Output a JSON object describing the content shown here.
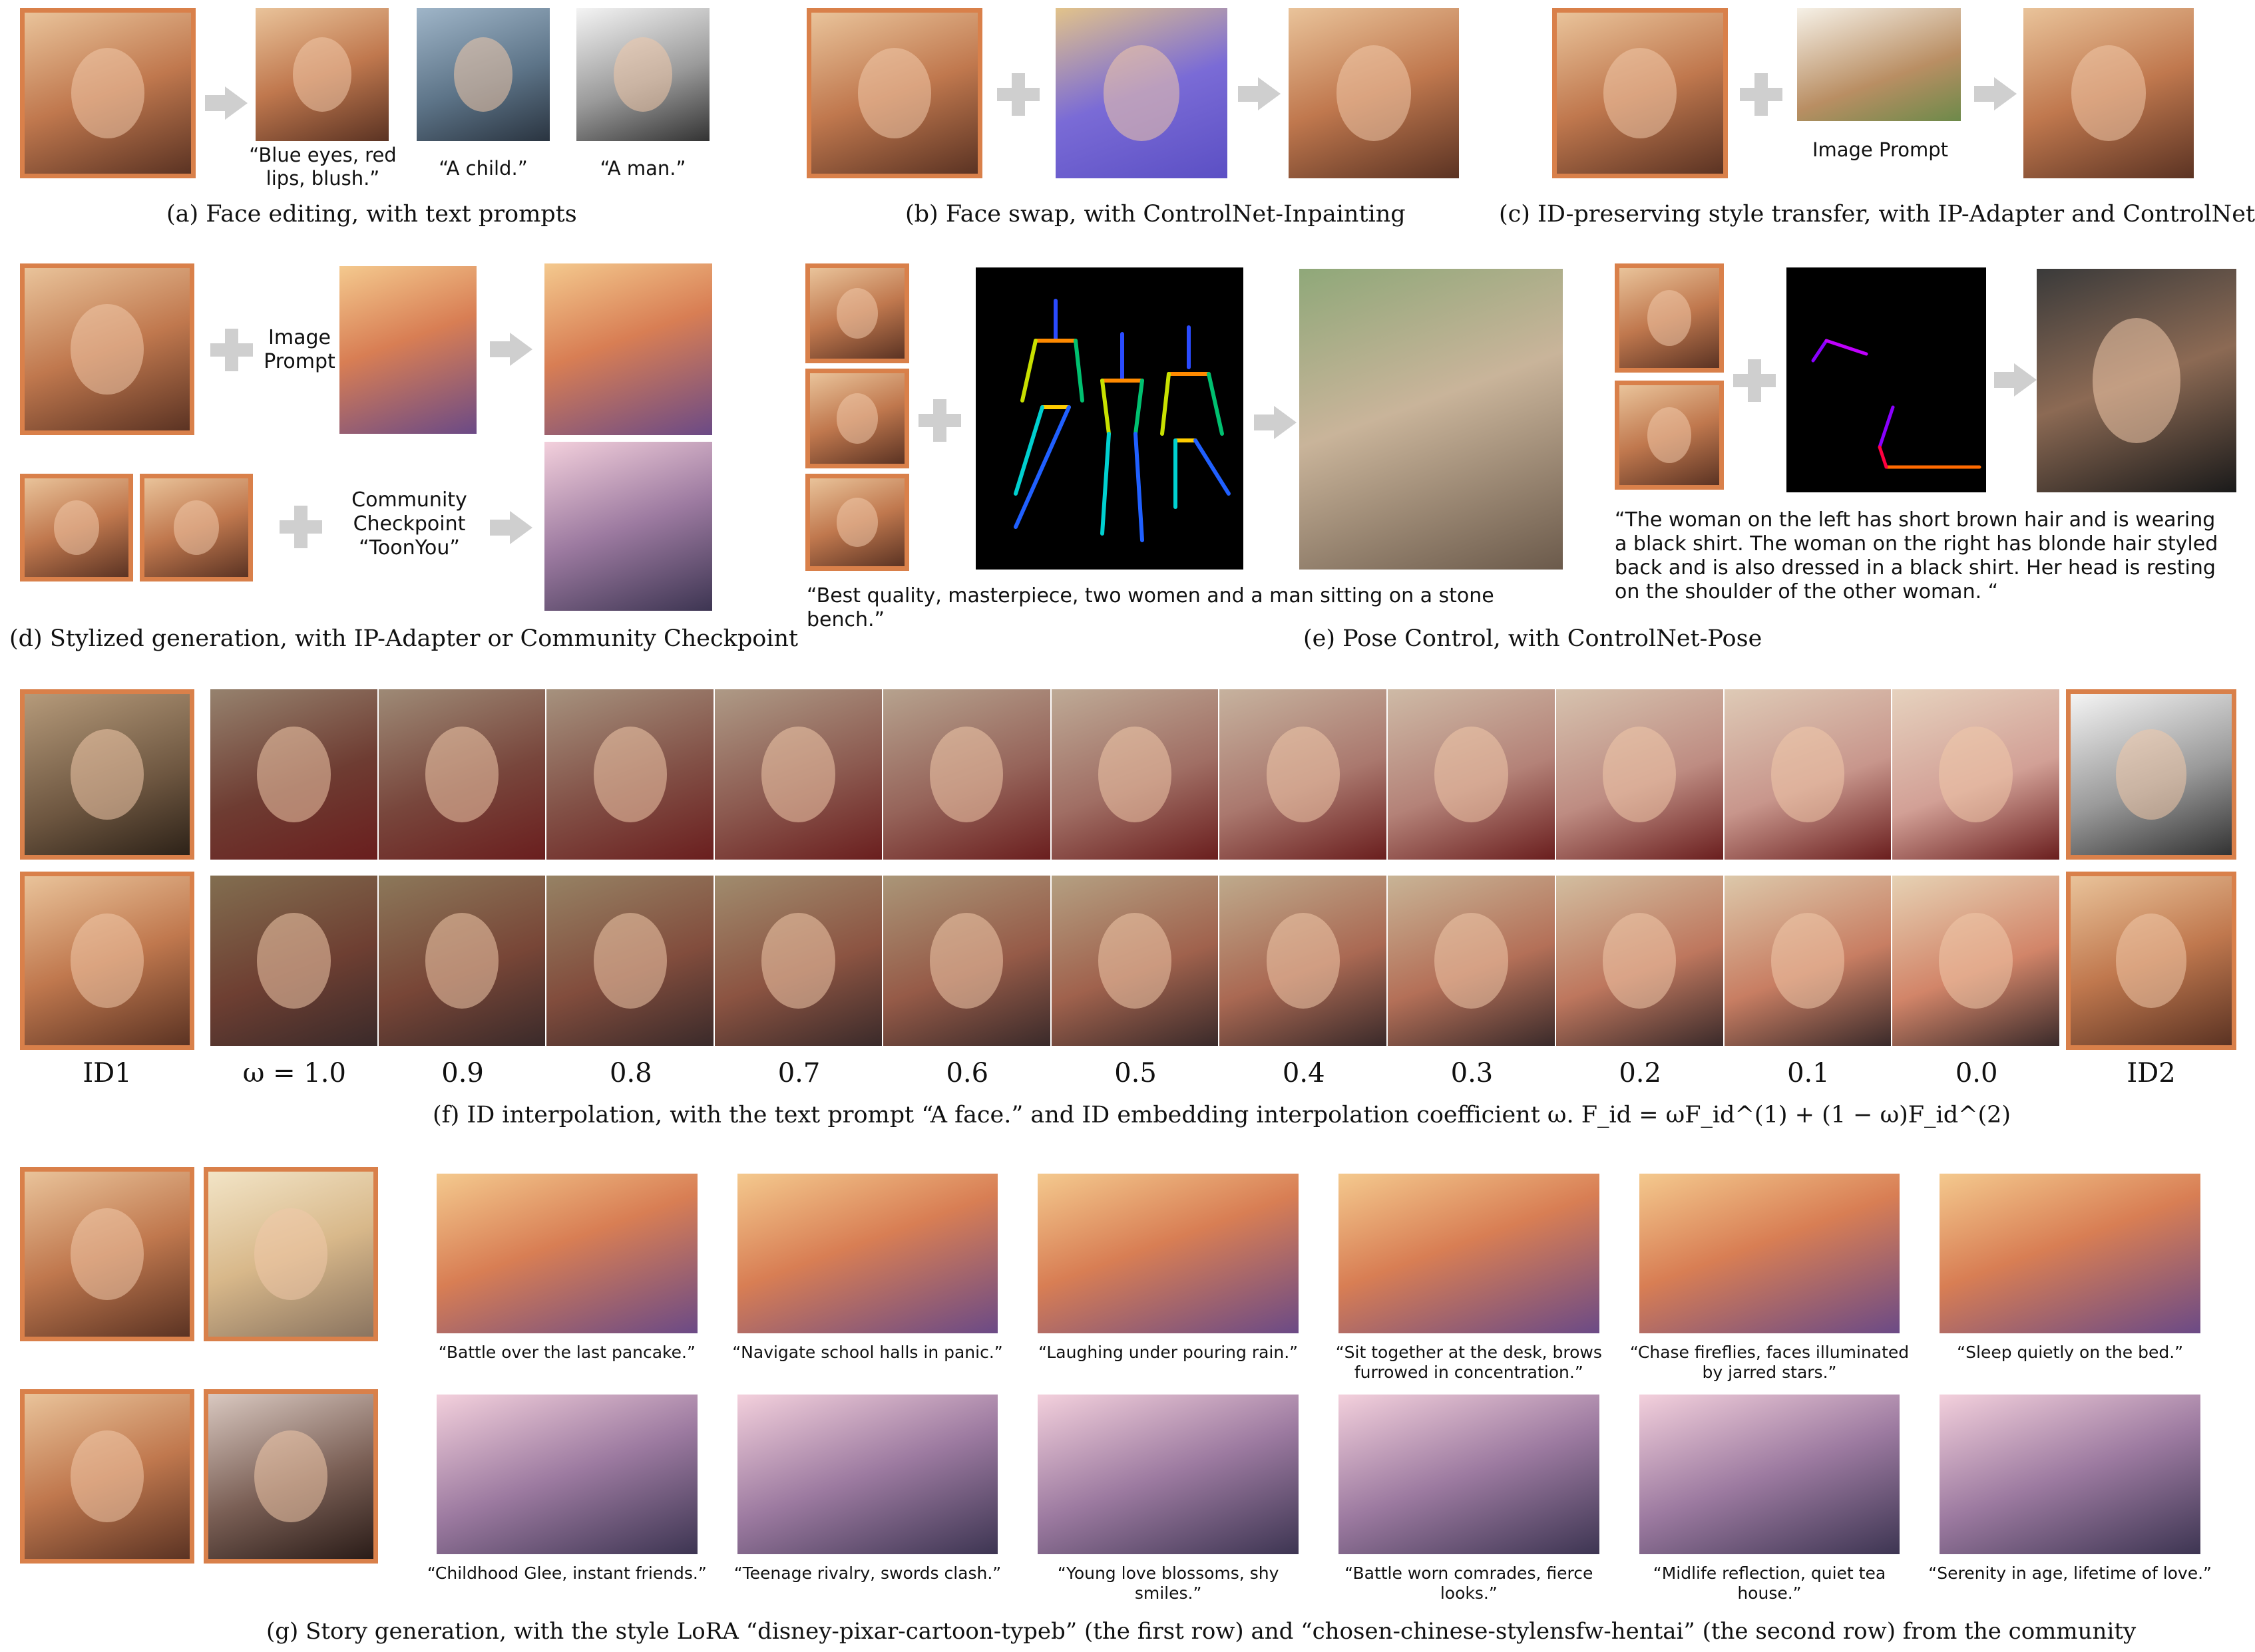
{
  "panels": {
    "a": {
      "caption": "(a) Face editing, with text prompts",
      "prompts": [
        "“Blue eyes, red lips, blush.”",
        "“A child.”",
        "“A man.”"
      ]
    },
    "b": {
      "caption": "(b) Face swap, with ControlNet-Inpainting"
    },
    "c": {
      "caption": "(c) ID-preserving style transfer, with IP-Adapter and ControlNet-Edge",
      "image_prompt_label": "Image Prompt"
    },
    "d": {
      "caption": "(d) Stylized generation, with IP-Adapter or Community Checkpoint",
      "image_prompt_label": "Image Prompt",
      "checkpoint_label": "Community Checkpoint “ToonYou”"
    },
    "e": {
      "caption": "(e) Pose Control, with ControlNet-Pose",
      "prompt_left": "“Best quality, masterpiece, two women and a man sitting on a stone bench.”",
      "prompt_right": "“The woman on the left has short brown hair and is wearing a black shirt. The woman on the right has blonde hair styled back and is also dressed in a black shirt. Her head is resting on the shoulder of the other woman. “"
    },
    "f": {
      "caption": "(f) ID interpolation, with the text prompt “A face.” and ID embedding interpolation coefficient ω. F_id = ωF_id^(1) + (1 − ω)F_id^(2)",
      "id1_label": "ID1",
      "id2_label": "ID2",
      "omega_labels": [
        "ω = 1.0",
        "0.9",
        "0.8",
        "0.7",
        "0.6",
        "0.5",
        "0.4",
        "0.3",
        "0.2",
        "0.1",
        "0.0"
      ]
    },
    "g": {
      "caption": "(g) Story generation, with the style LoRA “disney-pixar-cartoon-typeb” (the first row) and “chosen-chinese-stylensfw-hentai” (the second row) from the community",
      "row1_prompts": [
        "“Battle over the last pancake.”",
        "“Navigate school halls in panic.”",
        "“Laughing under pouring rain.”",
        "“Sit together at the desk, brows furrowed in concentration.”",
        "“Chase fireflies, faces illuminated by jarred stars.”",
        "“Sleep quietly on the bed.”"
      ],
      "row2_prompts": [
        "“Childhood Glee, instant friends.”",
        "“Teenage rivalry, swords clash.”",
        "“Young love blossoms, shy smiles.”",
        "“Battle worn comrades, fierce looks.”",
        "“Midlife reflection, quiet tea house.”",
        "“Serenity in age, lifetime of love.”"
      ]
    }
  },
  "colors": {
    "frame": "#d9804a",
    "connector": "#cfcfcf"
  }
}
